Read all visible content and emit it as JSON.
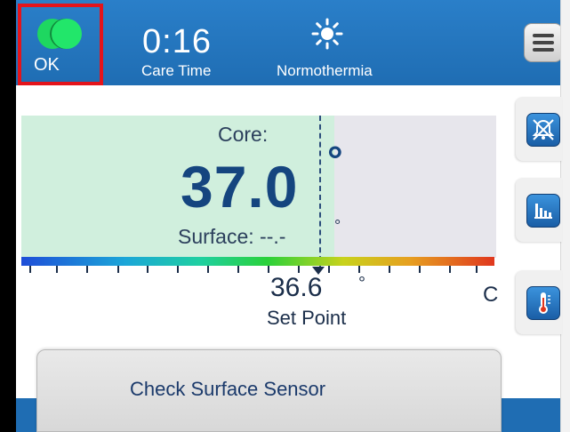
{
  "header": {
    "status_label": "OK",
    "care_time": {
      "value": "0:16",
      "label": "Care Time"
    },
    "mode": {
      "label": "Normothermia",
      "icon": "sun-icon"
    },
    "menu_icon": "hamburger-menu-icon"
  },
  "temperature": {
    "core_label": "Core:",
    "core_value": "37.0",
    "degree_symbol": "°",
    "surface_label": "Surface: --.-",
    "setpoint_value": "36.6",
    "unit": "C",
    "setpoint_label": "Set Point"
  },
  "tools": [
    {
      "icon": "alarm-silenced-icon"
    },
    {
      "icon": "bar-chart-icon"
    },
    {
      "icon": "thermometer-icon"
    }
  ],
  "notice": {
    "text": "Check Surface Sensor"
  },
  "colors": {
    "header_blue": "#1f6db3",
    "status_ok_green": "#1ed760",
    "highlight_red": "#e4141b",
    "temperature_text": "#15457f",
    "fill_green": "#d0efdd"
  }
}
